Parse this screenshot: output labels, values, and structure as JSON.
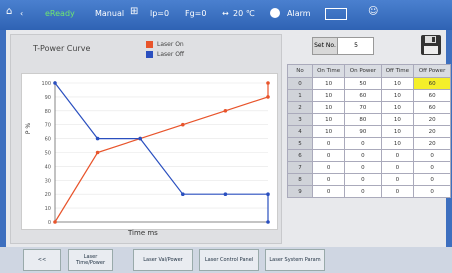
{
  "topbar": {
    "ready": "eReady",
    "mode": "Manual",
    "lp": "lp=0",
    "fg": "Fg=0",
    "temp": "20 ℃",
    "alarm": "Alarm"
  },
  "chart": {
    "title": "T-Power Curve",
    "legend": [
      "Laser On",
      "Laser Off"
    ],
    "xlabel": "Time ms",
    "ylabel": "P %"
  },
  "chart_data": {
    "type": "line",
    "title": "T-Power Curve",
    "xlabel": "Time ms",
    "ylabel": "P %",
    "ylim": [
      0,
      100
    ],
    "yticks": [
      0,
      10,
      20,
      30,
      40,
      50,
      60,
      70,
      80,
      90,
      100
    ],
    "grid": true,
    "legend_position": "top",
    "series": [
      {
        "name": "Laser On",
        "color": "#e8542b",
        "points": [
          [
            0,
            0
          ],
          [
            10,
            50
          ],
          [
            20,
            60
          ],
          [
            30,
            70
          ],
          [
            40,
            80
          ],
          [
            50,
            90
          ],
          [
            50,
            100
          ]
        ]
      },
      {
        "name": "Laser Off",
        "color": "#2a4fbf",
        "points": [
          [
            0,
            100
          ],
          [
            10,
            60
          ],
          [
            20,
            60
          ],
          [
            30,
            20
          ],
          [
            40,
            20
          ],
          [
            50,
            20
          ],
          [
            50,
            0
          ]
        ]
      }
    ]
  },
  "controls": {
    "set_label": "Set No.",
    "set_value": "5"
  },
  "table": {
    "headers": [
      "No",
      "On Time",
      "On Power",
      "Off Time",
      "Off Power"
    ],
    "rows": [
      [
        "0",
        "10",
        "50",
        "10",
        "60"
      ],
      [
        "1",
        "10",
        "60",
        "10",
        "60"
      ],
      [
        "2",
        "10",
        "70",
        "10",
        "60"
      ],
      [
        "3",
        "10",
        "80",
        "10",
        "20"
      ],
      [
        "4",
        "10",
        "90",
        "10",
        "20"
      ],
      [
        "5",
        "0",
        "0",
        "10",
        "20"
      ],
      [
        "6",
        "0",
        "0",
        "0",
        "0"
      ],
      [
        "7",
        "0",
        "0",
        "0",
        "0"
      ],
      [
        "8",
        "0",
        "0",
        "0",
        "0"
      ],
      [
        "9",
        "0",
        "0",
        "0",
        "0"
      ]
    ]
  },
  "bottom": {
    "back": "<<",
    "buttons": [
      "Laser Time/Power",
      "Laser Val/Power",
      "Laser Control Panel",
      "Laser System Param"
    ]
  }
}
